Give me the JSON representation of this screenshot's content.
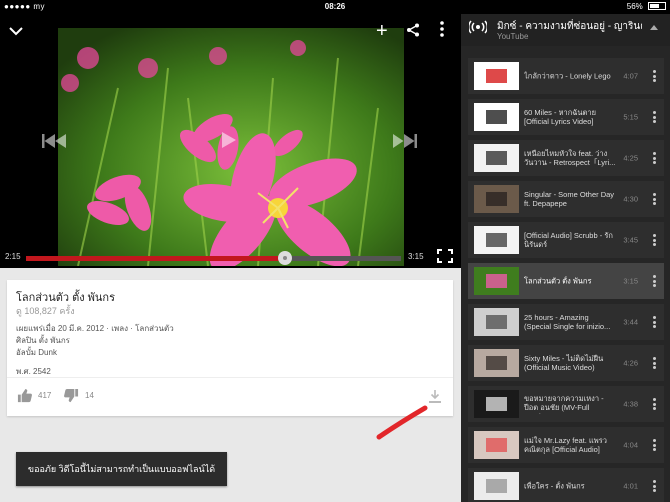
{
  "status_bar": {
    "carrier": "●●●●● my",
    "time": "08:26",
    "battery": "56%"
  },
  "player": {
    "elapsed": "2:15",
    "duration": "3:15",
    "progress": 0.69
  },
  "video_info": {
    "title": "โลกส่วนตัว ตั้ง พันกร",
    "views": "ดู 108,827 ครั้ง",
    "published": "เผยแพร่เมื่อ 20 มี.ค. 2012 · เพลง · โลกส่วนตัว",
    "artist": "ศิลปิน ตั้ง พันกร",
    "album": "อัลบั้ม Dunk",
    "year": "พ.ศ. 2542",
    "likes": "417",
    "dislikes": "14"
  },
  "offline_button": {
    "label": "ขออภัย วิดีโอนี้ไม่สามารถทำเป็นแบบออฟไลน์ได้"
  },
  "playlist": {
    "title": "มิกซ์ - ความงามที่ซ่อนอยู่ - ญารินดา",
    "subtitle": "YouTube",
    "items": [
      {
        "label": "ไกลักว่าดาว - Lonely Lego",
        "duration": "4:07"
      },
      {
        "label": "60 Miles - หากฉันตาย [Official Lyrics Video]",
        "duration": "5:15"
      },
      {
        "label": "เหนือยไหมหัวใจ feat. ว่าง วันวาน - Retrospect「Lyri...",
        "duration": "4:25"
      },
      {
        "label": "Singular - Some Other Day ft. Depapepe",
        "duration": "4:30"
      },
      {
        "label": "[Official Audio] Scrubb - รักนิรันดร์",
        "duration": "3:45"
      },
      {
        "label": "โลกส่วนตัว ตั้ง พันกร",
        "duration": "3:15",
        "active": true
      },
      {
        "label": "25 hours - Amazing (Special Single for inizio...",
        "duration": "3:44"
      },
      {
        "label": "Sixty Miles - ไม่ติดไม่ฝืน (Official Music Video)",
        "duration": "4:26"
      },
      {
        "label": "ขอหมายจากความเหงา - ปีอต อนชัย (MV-Full Versio...",
        "duration": "4:38"
      },
      {
        "label": "แม่ใจ Mr.Lazy feat. แพรว คณิตกุล [Official Audio]",
        "duration": "4:04"
      },
      {
        "label": "เพื่อใคร - ตั้ง พันกร",
        "duration": "4:01"
      }
    ]
  }
}
